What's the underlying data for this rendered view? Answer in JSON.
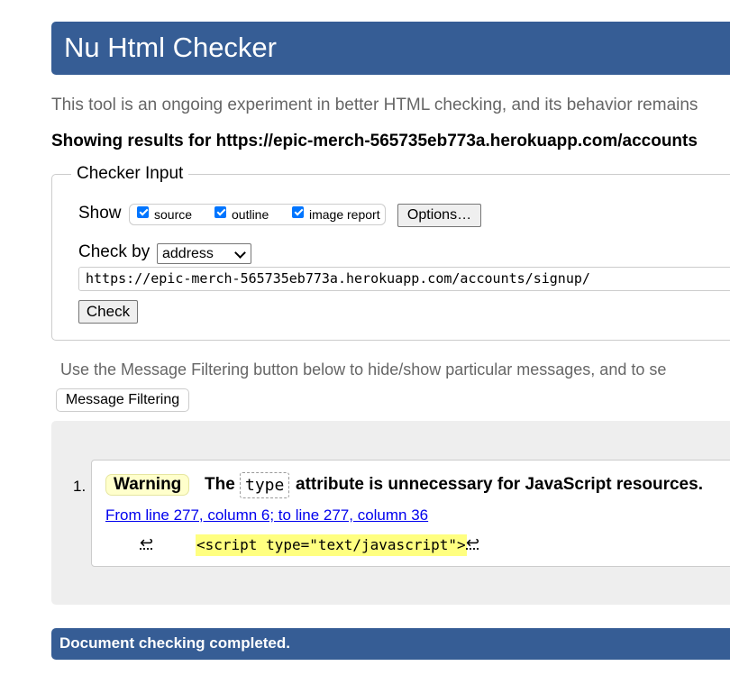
{
  "header": {
    "title": "Nu Html Checker"
  },
  "intro_text": "This tool is an ongoing experiment in better HTML checking, and its behavior remains",
  "showing_text": "Showing results for https://epic-merch-565735eb773a.herokuapp.com/accounts",
  "checker_input": {
    "legend": "Checker Input",
    "show_label": "Show",
    "options": [
      {
        "label": "source",
        "checked": true
      },
      {
        "label": "outline",
        "checked": true
      },
      {
        "label": "image report",
        "checked": true
      }
    ],
    "options_button": "Options…",
    "check_by_label": "Check by",
    "check_by_value": "address",
    "url_value": "https://epic-merch-565735eb773a.herokuapp.com/accounts/signup/",
    "check_button": "Check"
  },
  "filter_note": "Use the Message Filtering button below to hide/show particular messages, and to se",
  "filter_button": "Message Filtering",
  "results": [
    {
      "number": "1.",
      "type": "Warning",
      "message_prefix": "The",
      "message_code": "type",
      "message_suffix": "attribute is unnecessary for JavaScript resources.",
      "location": "From line 277, column 6; to line 277, column 36",
      "extract_return": "↩",
      "extract_code": "<script type=\"text/javascript\">",
      "extract_return_after": "↩"
    }
  ],
  "status": "Document checking completed.",
  "colors": {
    "header_bg": "#365d95",
    "warning_bg": "#ffffcc",
    "highlight": "#ffff80",
    "link": "#0000ee"
  }
}
